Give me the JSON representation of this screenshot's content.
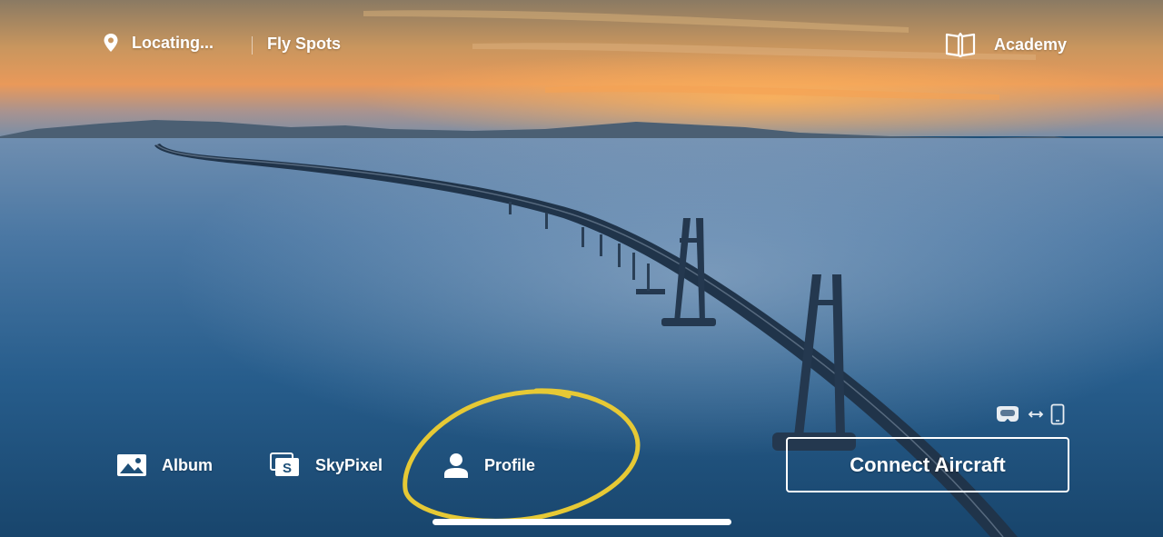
{
  "top_bar": {
    "location_icon": "location-pin-icon",
    "location_label": "Locating...",
    "fly_spots_label": "Fly Spots",
    "academy_icon": "open-book-icon",
    "academy_label": "Academy"
  },
  "bottom_bar": {
    "items": [
      {
        "label": "Album",
        "icon": "image-icon"
      },
      {
        "label": "SkyPixel",
        "icon": "skypixel-icon"
      },
      {
        "label": "Profile",
        "icon": "person-icon"
      }
    ],
    "connect_label": "Connect Aircraft",
    "device_link_icons": [
      "goggles-icon",
      "swap-arrows-icon",
      "phone-icon"
    ]
  },
  "colors": {
    "text": "#ffffff",
    "annotation_circle": "#e6c935",
    "sea": "#1d4f78",
    "sky_glow": "#f29a4a"
  }
}
